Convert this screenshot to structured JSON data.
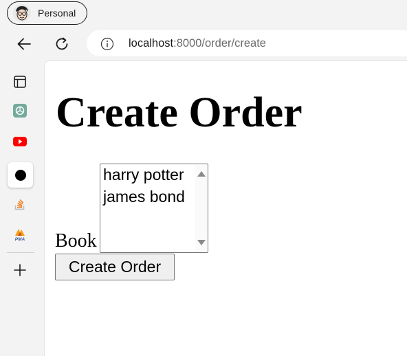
{
  "browser": {
    "profile_label": "Personal",
    "address_host": "localhost",
    "address_rest": ":8000/order/create",
    "icons": {
      "back": "arrow-left-icon",
      "reload": "reload-icon",
      "site_info": "info-icon"
    }
  },
  "sidebar": {
    "items": [
      {
        "icon": "tab-layout-icon"
      },
      {
        "icon": "chatgpt-icon",
        "color": "#74aa9c"
      },
      {
        "icon": "youtube-icon",
        "color": "#ff0000"
      },
      {
        "icon": "black-dot-icon",
        "active": true
      },
      {
        "icon": "stack-overflow-icon",
        "color": "#f48024"
      },
      {
        "icon": "pma-icon",
        "color": "#f89c0e"
      }
    ],
    "add_icon": "plus-icon"
  },
  "page": {
    "title": "Create Order",
    "book_label": "Book",
    "book_options": [
      "harry potter",
      "james bond"
    ],
    "submit_label": "Create Order"
  }
}
